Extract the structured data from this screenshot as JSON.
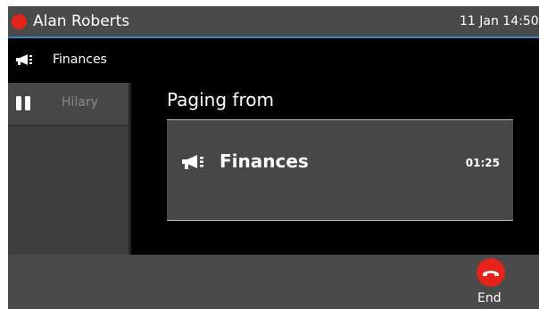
{
  "status_bar": {
    "user_name": "Alan Roberts",
    "presence_color": "#e5231b",
    "datetime": "11 Jan 14:50"
  },
  "line": {
    "label": "Finances",
    "icon": "megaphone-icon"
  },
  "side_panel": {
    "items": [
      {
        "label": "Hilary",
        "icon": "pause-icon"
      }
    ]
  },
  "main": {
    "title": "Paging from",
    "call": {
      "group": "Finances",
      "timer": "01:25",
      "icon": "megaphone-icon"
    }
  },
  "softkeys": {
    "end": {
      "label": "End",
      "icon": "hang-up-icon",
      "color": "#e5231b"
    }
  }
}
